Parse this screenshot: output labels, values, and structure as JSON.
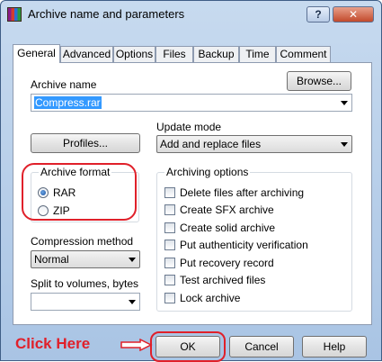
{
  "window": {
    "title": "Archive name and parameters",
    "help_label": "?",
    "close_label": "✕"
  },
  "tabs": [
    {
      "label": "General",
      "active": true
    },
    {
      "label": "Advanced"
    },
    {
      "label": "Options"
    },
    {
      "label": "Files"
    },
    {
      "label": "Backup"
    },
    {
      "label": "Time"
    },
    {
      "label": "Comment"
    }
  ],
  "archive_name": {
    "label": "Archive name",
    "value": "Compress.rar",
    "browse_label": "Browse..."
  },
  "profiles_label": "Profiles...",
  "update_mode": {
    "label": "Update mode",
    "value": "Add and replace files"
  },
  "archive_format": {
    "label": "Archive format",
    "options": [
      {
        "label": "RAR",
        "checked": true
      },
      {
        "label": "ZIP",
        "checked": false
      }
    ]
  },
  "archiving_options": {
    "label": "Archiving options",
    "items": [
      {
        "label": "Delete files after archiving",
        "checked": false
      },
      {
        "label": "Create SFX archive",
        "checked": false
      },
      {
        "label": "Create solid archive",
        "checked": false
      },
      {
        "label": "Put authenticity verification",
        "checked": false
      },
      {
        "label": "Put recovery record",
        "checked": false
      },
      {
        "label": "Test archived files",
        "checked": false
      },
      {
        "label": "Lock archive",
        "checked": false
      }
    ]
  },
  "compression": {
    "label": "Compression method",
    "value": "Normal"
  },
  "split": {
    "label": "Split to volumes, bytes",
    "value": ""
  },
  "annotation": {
    "text": "Click Here",
    "color": "#e0202a"
  },
  "buttons": {
    "ok": "OK",
    "cancel": "Cancel",
    "help": "Help"
  }
}
